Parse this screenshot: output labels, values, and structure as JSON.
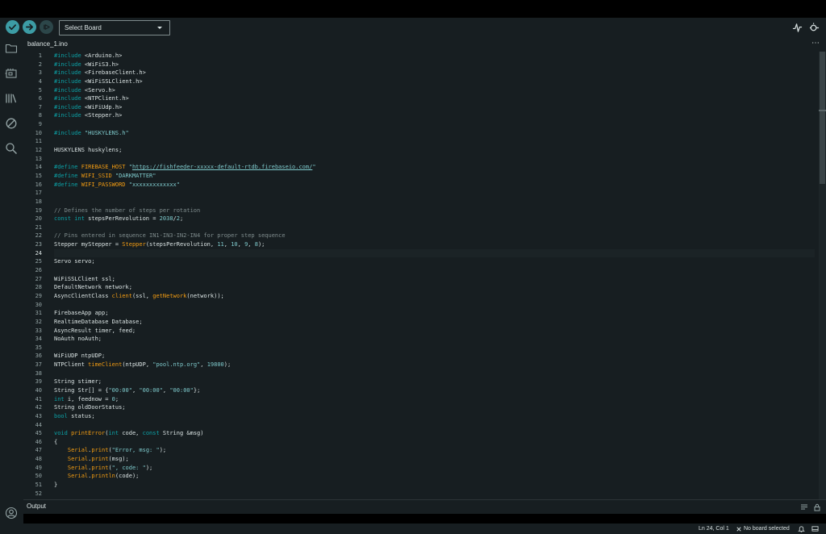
{
  "toolbar": {
    "verify_icon": "check-icon",
    "upload_icon": "arrow-right-icon",
    "debug_icon": "debug-icon",
    "board_select": "Select Board",
    "serial_plotter_icon": "serial-plotter-icon",
    "serial_monitor_icon": "serial-monitor-icon"
  },
  "sidebar": {
    "items": [
      "sketchbook-folder-icon",
      "boards-manager-icon",
      "library-manager-icon",
      "debug-icon",
      "search-icon"
    ],
    "bottom": "profile-icon"
  },
  "tabs": [
    {
      "label": "balance_1.ino"
    }
  ],
  "tab_more": "⋯",
  "editor": {
    "active_line": 24,
    "colors": {
      "keyword": "#0ca1a6",
      "function": "#f39c12",
      "string": "#7fcbcd",
      "comment": "#7f8c8d",
      "text": "#dae3e3",
      "background": "#171e21"
    },
    "lines": [
      [
        [
          "kw",
          "#include"
        ],
        [
          "t",
          " <Arduino.h>"
        ]
      ],
      [
        [
          "kw",
          "#include"
        ],
        [
          "t",
          " <WiFiS3.h>"
        ]
      ],
      [
        [
          "kw",
          "#include"
        ],
        [
          "t",
          " <FirebaseClient.h>"
        ]
      ],
      [
        [
          "kw",
          "#include"
        ],
        [
          "t",
          " <WiFiSSLClient.h>"
        ]
      ],
      [
        [
          "kw",
          "#include"
        ],
        [
          "t",
          " <Servo.h>"
        ]
      ],
      [
        [
          "kw",
          "#include"
        ],
        [
          "t",
          " <NTPClient.h>"
        ]
      ],
      [
        [
          "kw",
          "#include"
        ],
        [
          "t",
          " <WiFiUdp.h>"
        ]
      ],
      [
        [
          "kw",
          "#include"
        ],
        [
          "t",
          " <Stepper.h>"
        ]
      ],
      [],
      [
        [
          "kw",
          "#include"
        ],
        [
          "t",
          " "
        ],
        [
          "str",
          "\"HUSKYLENS.h\""
        ]
      ],
      [],
      [
        [
          "t",
          "HUSKYLENS huskylens;"
        ]
      ],
      [],
      [
        [
          "kw",
          "#define"
        ],
        [
          "t",
          " "
        ],
        [
          "fn",
          "FIREBASE_HOST"
        ],
        [
          "t",
          " "
        ],
        [
          "str",
          "\""
        ],
        [
          "link",
          "https://fishfeeder-xxxxx-default-rtdb.firebaseio.com/"
        ],
        [
          "str",
          "\""
        ]
      ],
      [
        [
          "kw",
          "#define"
        ],
        [
          "t",
          " "
        ],
        [
          "fn",
          "WIFI_SSID"
        ],
        [
          "t",
          " "
        ],
        [
          "str",
          "\"DARKMATTER\""
        ]
      ],
      [
        [
          "kw",
          "#define"
        ],
        [
          "t",
          " "
        ],
        [
          "fn",
          "WIFI_PASSWORD"
        ],
        [
          "t",
          " "
        ],
        [
          "str",
          "\"xxxxxxxxxxxxx\""
        ]
      ],
      [],
      [],
      [
        [
          "cmt",
          "// Defines the number of steps per rotation"
        ]
      ],
      [
        [
          "kw",
          "const"
        ],
        [
          "t",
          " "
        ],
        [
          "kw",
          "int"
        ],
        [
          "t",
          " stepsPerRevolution = "
        ],
        [
          "num",
          "2038"
        ],
        [
          "t",
          "/"
        ],
        [
          "num",
          "2"
        ],
        [
          "t",
          ";"
        ]
      ],
      [],
      [
        [
          "cmt",
          "// Pins entered in sequence IN1-IN3-IN2-IN4 for proper step sequence"
        ]
      ],
      [
        [
          "t",
          "Stepper myStepper = "
        ],
        [
          "fn",
          "Stepper"
        ],
        [
          "t",
          "(stepsPerRevolution, "
        ],
        [
          "num",
          "11"
        ],
        [
          "t",
          ", "
        ],
        [
          "num",
          "10"
        ],
        [
          "t",
          ", "
        ],
        [
          "num",
          "9"
        ],
        [
          "t",
          ", "
        ],
        [
          "num",
          "8"
        ],
        [
          "t",
          ");"
        ]
      ],
      [],
      [
        [
          "t",
          "Servo servo;"
        ]
      ],
      [],
      [
        [
          "t",
          "WiFiSSLClient ssl;"
        ]
      ],
      [
        [
          "t",
          "DefaultNetwork network;"
        ]
      ],
      [
        [
          "t",
          "AsyncClientClass "
        ],
        [
          "fn",
          "client"
        ],
        [
          "t",
          "(ssl, "
        ],
        [
          "fn",
          "getNetwork"
        ],
        [
          "t",
          "(network));"
        ]
      ],
      [],
      [
        [
          "t",
          "FirebaseApp app;"
        ]
      ],
      [
        [
          "t",
          "RealtimeDatabase Database;"
        ]
      ],
      [
        [
          "t",
          "AsyncResult timer, feed;"
        ]
      ],
      [
        [
          "t",
          "NoAuth noAuth;"
        ]
      ],
      [],
      [
        [
          "t",
          "WiFiUDP ntpUDP;"
        ]
      ],
      [
        [
          "t",
          "NTPClient "
        ],
        [
          "fn",
          "timeClient"
        ],
        [
          "t",
          "(ntpUDP, "
        ],
        [
          "str",
          "\"pool.ntp.org\""
        ],
        [
          "t",
          ", "
        ],
        [
          "num",
          "19800"
        ],
        [
          "t",
          ");"
        ]
      ],
      [],
      [
        [
          "t",
          "String stimer;"
        ]
      ],
      [
        [
          "t",
          "String Str[] = {"
        ],
        [
          "str",
          "\"00:00\""
        ],
        [
          "t",
          ", "
        ],
        [
          "str",
          "\"00:00\""
        ],
        [
          "t",
          ", "
        ],
        [
          "str",
          "\"00:00\""
        ],
        [
          "t",
          "};"
        ]
      ],
      [
        [
          "kw",
          "int"
        ],
        [
          "t",
          " i, feednow = "
        ],
        [
          "num",
          "0"
        ],
        [
          "t",
          ";"
        ]
      ],
      [
        [
          "t",
          "String oldDoorStatus;"
        ]
      ],
      [
        [
          "kw",
          "bool"
        ],
        [
          "t",
          " status;"
        ]
      ],
      [],
      [
        [
          "kw",
          "void"
        ],
        [
          "t",
          " "
        ],
        [
          "fn",
          "printError"
        ],
        [
          "t",
          "("
        ],
        [
          "kw",
          "int"
        ],
        [
          "t",
          " code, "
        ],
        [
          "kw",
          "const"
        ],
        [
          "t",
          " String &msg)"
        ]
      ],
      [
        [
          "t",
          "{"
        ]
      ],
      [
        [
          "t",
          "    "
        ],
        [
          "fn",
          "Serial"
        ],
        [
          "t",
          "."
        ],
        [
          "fn",
          "print"
        ],
        [
          "t",
          "("
        ],
        [
          "str",
          "\"Error, msg: \""
        ],
        [
          "t",
          ");"
        ]
      ],
      [
        [
          "t",
          "    "
        ],
        [
          "fn",
          "Serial"
        ],
        [
          "t",
          "."
        ],
        [
          "fn",
          "print"
        ],
        [
          "t",
          "(msg);"
        ]
      ],
      [
        [
          "t",
          "    "
        ],
        [
          "fn",
          "Serial"
        ],
        [
          "t",
          "."
        ],
        [
          "fn",
          "print"
        ],
        [
          "t",
          "("
        ],
        [
          "str",
          "\", code: \""
        ],
        [
          "t",
          ");"
        ]
      ],
      [
        [
          "t",
          "    "
        ],
        [
          "fn",
          "Serial"
        ],
        [
          "t",
          "."
        ],
        [
          "fn",
          "println"
        ],
        [
          "t",
          "(code);"
        ]
      ],
      [
        [
          "t",
          "}"
        ]
      ],
      []
    ]
  },
  "output": {
    "label": "Output"
  },
  "statusbar": {
    "position": "Ln 24, Col 1",
    "board": "No board selected"
  }
}
